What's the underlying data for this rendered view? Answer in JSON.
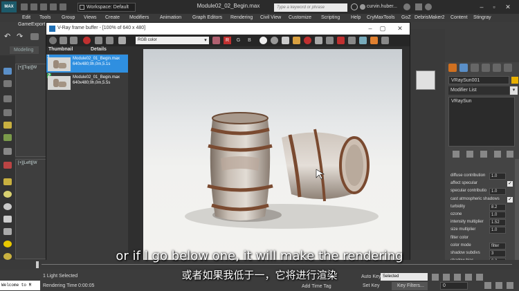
{
  "app": {
    "document_title": "Module02_02_Begin.max",
    "workspace_label": "Workspace: Default",
    "search_placeholder": "Type a keyword or phrase",
    "user_name": "curvin.huber...",
    "logo_text": "MAX"
  },
  "menu": {
    "items": [
      "Edit",
      "Tools",
      "Group",
      "Views",
      "Create",
      "Modifiers",
      "Animation",
      "Graph Editors",
      "Rendering",
      "Civil View",
      "Customize",
      "Scripting",
      "Help",
      "CryMaxTools",
      "GoZ",
      "DebrisMaker2",
      "Content",
      "Stingray"
    ],
    "game_export": "GameExport"
  },
  "ribbon": {
    "modeling_tab": "Modeling"
  },
  "viewports": {
    "top_label": "[+][Top][W",
    "left_label": "[+][Left][W"
  },
  "frame_buffer": {
    "title": "V-Ray frame buffer - [100% of 640 x 480]",
    "channel_select": "RGB color",
    "channel_buttons": [
      "R",
      "G",
      "B"
    ],
    "history_headers": {
      "thumbnail": "Thumbnail",
      "details": "Details"
    },
    "history": [
      {
        "num": "1",
        "line1": "Module02_01_Begin.max",
        "line2": "640x480;0h,0m,5.1s",
        "selected": true
      },
      {
        "num": "2",
        "line1": "Module02_01_Begin.max",
        "line2": "640x480;0h,0m,5.5s",
        "selected": false
      }
    ]
  },
  "command_panel": {
    "object_name": "VRaySun001",
    "object_color": "#e8b000",
    "modifier_list": "Modifier List",
    "stack_item": "VRaySun",
    "params": [
      {
        "label": "diffuse contribution",
        "value": "1.0",
        "check": false
      },
      {
        "label": "affect specular",
        "value": "",
        "check": true
      },
      {
        "label": "specular contributio",
        "value": "1.0",
        "check": false
      },
      {
        "label": "cast atmospheric shadows",
        "value": "",
        "check": true
      },
      {
        "label": "turbidity",
        "value": "8.2",
        "check": false
      },
      {
        "label": "ozone",
        "value": "1.0",
        "check": false
      },
      {
        "label": "intensity multiplier",
        "value": "1.52",
        "check": false
      },
      {
        "label": "size multiplier",
        "value": "1.0",
        "check": false
      },
      {
        "label": "filter color",
        "value": "",
        "check": false
      },
      {
        "label": "color mode",
        "value": "filter",
        "check": false
      },
      {
        "label": "shadow subdivs",
        "value": "3",
        "check": false
      },
      {
        "label": "shadow bias",
        "value": "0.2",
        "check": false
      }
    ]
  },
  "status": {
    "maxscript": "Welcome to M",
    "light_selected": "1 Light Selected",
    "render_time_label": "Rendering Time",
    "render_time_value": "0:00:05",
    "add_time_tag": "Add Time Tag",
    "auto_key": "Auto Key",
    "selected": "Selected",
    "set_key": "Set Key",
    "key_filters": "Key Filters...",
    "frame_value": "0"
  },
  "subtitles": {
    "english": "or if I go below one, it will make the rendering",
    "chinese": "或者如果我低于一，它将进行渲染"
  },
  "colors": {
    "accent_blue": "#3d7fd1",
    "history_selected": "#2f8fe0",
    "rgb_red": "#c03030"
  }
}
